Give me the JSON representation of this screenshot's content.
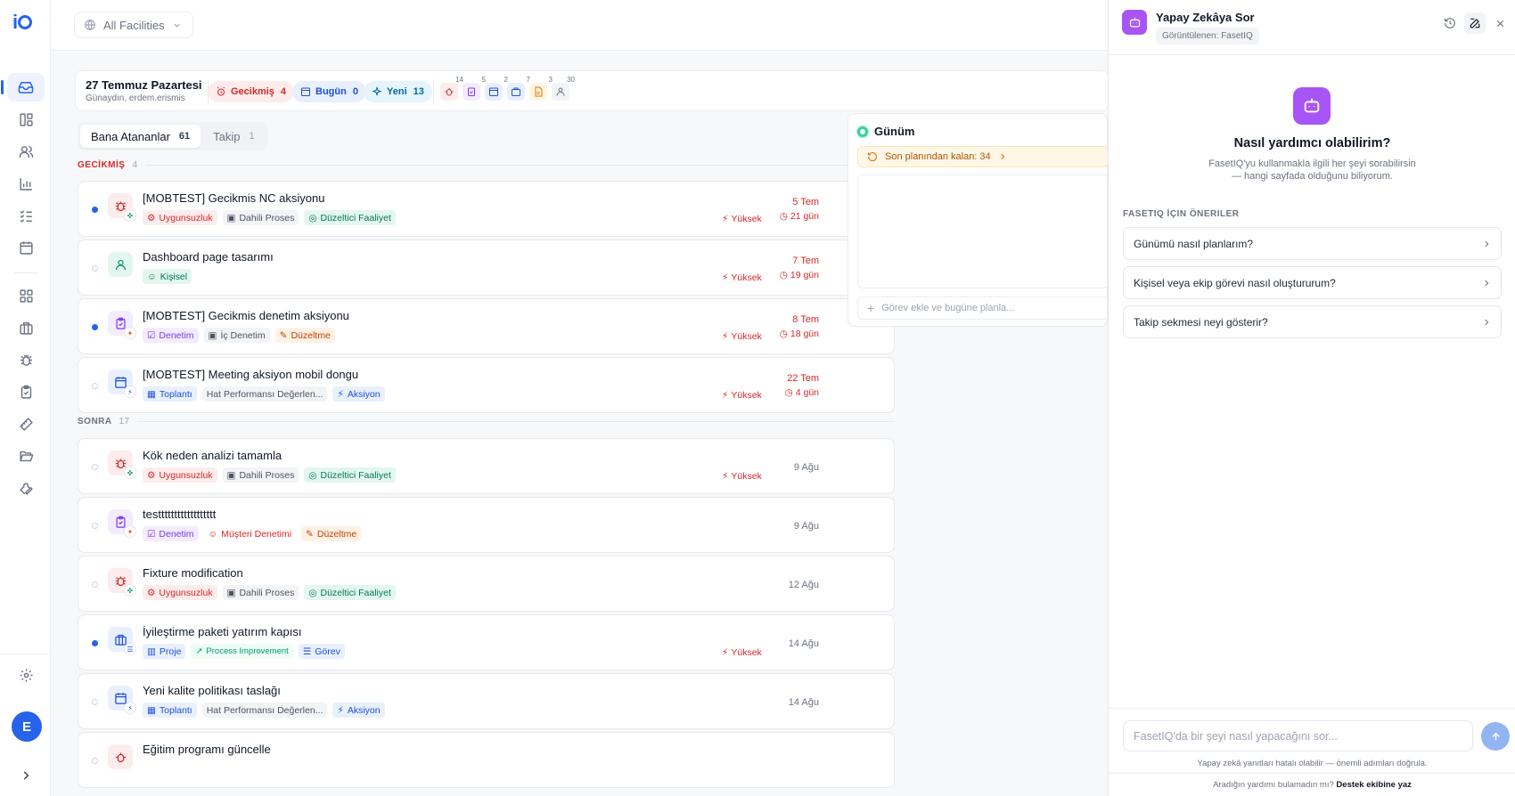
{
  "facility": {
    "label": "All Facilities"
  },
  "user": {
    "initial": "E"
  },
  "day": {
    "title": "27 Temmuz Pazartesi",
    "greeting": "Günaydın, erdem.erismis",
    "overdue_label": "Gecikmiş",
    "overdue_count": "4",
    "today_label": "Bugün",
    "today_count": "0",
    "new_label": "Yeni",
    "new_count": "13",
    "mini_counts": [
      "14",
      "5",
      "2",
      "7",
      "3",
      "30"
    ]
  },
  "tabs": [
    {
      "label": "Bana Atananlar",
      "count": "61"
    },
    {
      "label": "Takip",
      "count": "1"
    }
  ],
  "sections": {
    "overdue": {
      "label": "GECİKMİŞ",
      "count": "4"
    },
    "later": {
      "label": "SONRA",
      "count": "17"
    }
  },
  "tasks": [
    {
      "title": "[MOBTEST] Gecikmis NC aksiyonu",
      "tags": [
        "Uygunsuzluk",
        "Dahili Proses",
        "Düzeltici Faaliyet"
      ],
      "priority": "Yüksek",
      "date": "5 Tem",
      "ago": "21 gün"
    },
    {
      "title": "Dashboard page tasarımı",
      "tags": [
        "Kişisel"
      ],
      "priority": "Yüksek",
      "date": "7 Tem",
      "ago": "19 gün"
    },
    {
      "title": "[MOBTEST] Gecikmis denetim aksiyonu",
      "tags": [
        "Denetim",
        "İç Denetim",
        "Düzeltme"
      ],
      "priority": "Yüksek",
      "date": "8 Tem",
      "ago": "18 gün"
    },
    {
      "title": "[MOBTEST] Meeting aksiyon mobil dongu",
      "tags": [
        "Toplantı",
        "Hat Performansı Değerlen...",
        "Aksiyon"
      ],
      "priority": "Yüksek",
      "date": "22 Tem",
      "ago": "4 gün"
    },
    {
      "title": "Kök neden analizi tamamla",
      "tags": [
        "Uygunsuzluk",
        "Dahili Proses",
        "Düzeltici Faaliyet"
      ],
      "priority": "Yüksek",
      "date": "9 Ağu"
    },
    {
      "title": "testttttttttttttttttt",
      "tags": [
        "Denetim",
        "Müşteri Denetimi",
        "Düzeltme"
      ],
      "date": "9 Ağu"
    },
    {
      "title": "Fixture modification",
      "tags": [
        "Uygunsuzluk",
        "Dahili Proses",
        "Düzeltici Faaliyet"
      ],
      "date": "12 Ağu"
    },
    {
      "title": "İyileştirme paketi yatırım kapısı",
      "tags": [
        "Proje",
        "Process Improvement",
        "Görev"
      ],
      "priority": "Yüksek",
      "date": "14 Ağu"
    },
    {
      "title": "Yeni kalite politikası taslağı",
      "tags": [
        "Toplantı",
        "Hat Performansı Değerlen...",
        "Aksiyon"
      ],
      "date": "14 Ağu"
    },
    {
      "title": "Eğitim programı güncelle"
    }
  ],
  "gunum": {
    "title": "Günüm",
    "plan_remaining": "Son planından kalan: 34",
    "add_placeholder": "Görev ekle ve bugüne planla..."
  },
  "ai": {
    "title": "Yapay Zekâya Sor",
    "context": "Görüntülenen: FasetIQ",
    "question": "Nasıl yardımcı olabilirim?",
    "desc1": "FasetIQ'yu kullanmakla ilgili her şeyi sorabilirsin",
    "desc2": "— hangi sayfada olduğunu biliyorum.",
    "suggestions_header": "FASETIQ İÇIN ÖNERILER",
    "suggestions": [
      "Günümü nasıl planlarım?",
      "Kişisel veya ekip görevi nasıl oluştururum?",
      "Takip sekmesi neyi gösterir?"
    ],
    "input_placeholder": "FasetIQ'da bir şeyi nasıl yapacağını sor...",
    "disclaimer": "Yapay zekâ yanıtları hatalı olabilir — önemli adımları doğrula.",
    "help_text": "Aradığın yardımı bulamadın mı?",
    "help_link": "Destek ekibine yaz"
  }
}
